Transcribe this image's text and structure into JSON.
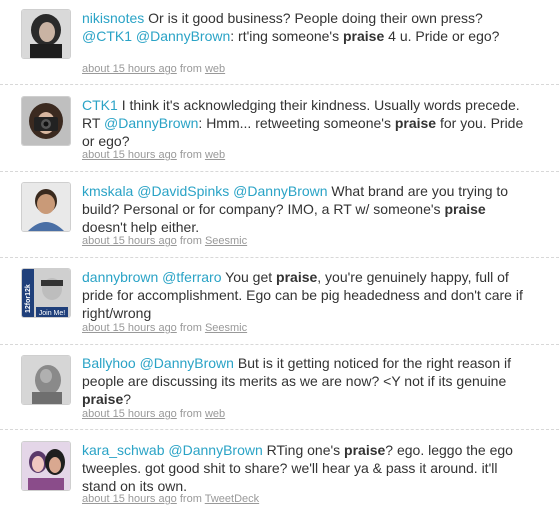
{
  "tweets": [
    {
      "username": "nikisnotes",
      "text_parts": [
        {
          "t": "Or is it good business? People doing their own press? "
        },
        {
          "t": "@CTK1",
          "kind": "mention"
        },
        {
          "t": " "
        },
        {
          "t": "@DannyBrown",
          "kind": "mention"
        },
        {
          "t": ": rt'ing someone's "
        },
        {
          "t": "praise",
          "kind": "kw"
        },
        {
          "t": " 4 u. Pride or ego?"
        }
      ],
      "time": "about 15 hours ago",
      "from_label": "from",
      "source": "web",
      "avatar_icon": "profile-photo-woman-dark-hair"
    },
    {
      "username": "CTK1",
      "text_parts": [
        {
          "t": "I think it's acknowledging their kindness. Usually words precede. RT "
        },
        {
          "t": "@DannyBrown",
          "kind": "mention"
        },
        {
          "t": ": Hmm... retweeting someone's "
        },
        {
          "t": "praise",
          "kind": "kw"
        },
        {
          "t": " for you. Pride or ego?"
        }
      ],
      "time": "about 15 hours ago",
      "from_label": "from",
      "source": "web",
      "avatar_icon": "profile-photo-woman-camera"
    },
    {
      "username": "kmskala",
      "text_parts": [
        {
          "t": "@DavidSpinks",
          "kind": "mention"
        },
        {
          "t": " "
        },
        {
          "t": "@DannyBrown",
          "kind": "mention"
        },
        {
          "t": " What brand are you trying to build? Personal or for company? IMO, a RT w/ someone's "
        },
        {
          "t": "praise",
          "kind": "kw"
        },
        {
          "t": " doesn't help either."
        }
      ],
      "time": "about 15 hours ago",
      "from_label": "from",
      "source": "Seesmic",
      "avatar_icon": "profile-photo-man-smiling"
    },
    {
      "username": "dannybrown",
      "text_parts": [
        {
          "t": "@tferraro",
          "kind": "mention"
        },
        {
          "t": " You get "
        },
        {
          "t": "praise",
          "kind": "kw"
        },
        {
          "t": ", you're genuinely happy, full of pride for accomplishment. Ego can be pig headedness and don't care if right/wrong"
        }
      ],
      "time": "about 15 hours ago",
      "from_label": "from",
      "source": "Seesmic",
      "avatar_icon": "profile-photo-12for12-badge",
      "avatar_badge_text": "12for12k",
      "avatar_join_text": "Join Me!"
    },
    {
      "username": "Ballyhoo",
      "text_parts": [
        {
          "t": "@DannyBrown",
          "kind": "mention"
        },
        {
          "t": " But is it getting noticed for the right reason if people are discussing its merits as we are now? <Y not if its genuine "
        },
        {
          "t": "praise",
          "kind": "kw"
        },
        {
          "t": "?"
        }
      ],
      "time": "about 15 hours ago",
      "from_label": "from",
      "source": "web",
      "avatar_icon": "profile-photo-grey-figure"
    },
    {
      "username": "kara_schwab",
      "text_parts": [
        {
          "t": "@DannyBrown",
          "kind": "mention"
        },
        {
          "t": " RTing one's "
        },
        {
          "t": "praise",
          "kind": "kw"
        },
        {
          "t": "? ego. leggo the ego tweeples. got good shit to share? we'll hear ya & pass it around. it'll stand on its own."
        }
      ],
      "time": "about 15 hours ago",
      "from_label": "from",
      "source": "TweetDeck",
      "avatar_icon": "profile-photo-two-women"
    }
  ]
}
